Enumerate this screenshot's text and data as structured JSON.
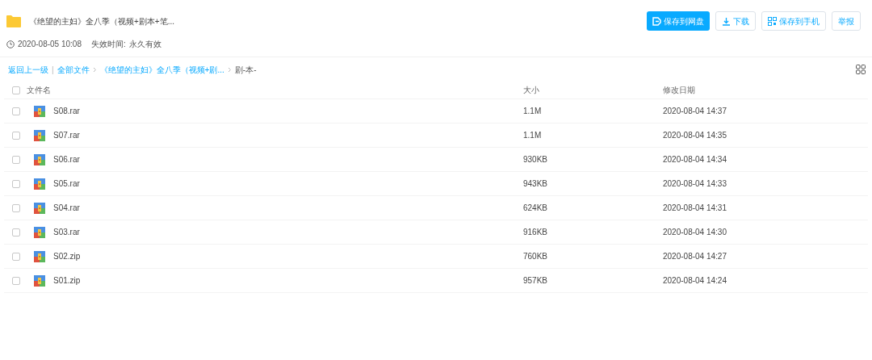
{
  "share": {
    "title": "《绝望的主妇》全八季（视频+剧本+笔...",
    "created": "2020-08-05 10:08",
    "expiry_label": "失效时间:",
    "expiry": "永久有效"
  },
  "actions": [
    {
      "kind": "save",
      "label": "保存到网盘"
    },
    {
      "kind": "download",
      "label": "下载"
    },
    {
      "kind": "phone",
      "label": "保存到手机"
    },
    {
      "kind": "report",
      "label": "举报"
    }
  ],
  "breadcrumb": {
    "back": "返回上一级",
    "divider": "|",
    "items": [
      {
        "label": "全部文件",
        "current": false
      },
      {
        "label": "《绝望的主妇》全八季（视频+剧...",
        "current": false
      },
      {
        "label": "剧-本-",
        "current": true
      }
    ]
  },
  "table": {
    "all_checked": false,
    "columns": [
      "文件名",
      "大小",
      "修改日期"
    ],
    "rows": [
      {
        "name": "S08.rar",
        "size": "1.1M",
        "date": "2020-08-04 14:37",
        "checked": false
      },
      {
        "name": "S07.rar",
        "size": "1.1M",
        "date": "2020-08-04 14:35",
        "checked": false
      },
      {
        "name": "S06.rar",
        "size": "930KB",
        "date": "2020-08-04 14:34",
        "checked": false
      },
      {
        "name": "S05.rar",
        "size": "943KB",
        "date": "2020-08-04 14:33",
        "checked": false
      },
      {
        "name": "S04.rar",
        "size": "624KB",
        "date": "2020-08-04 14:31",
        "checked": false
      },
      {
        "name": "S03.rar",
        "size": "916KB",
        "date": "2020-08-04 14:30",
        "checked": false
      },
      {
        "name": "S02.zip",
        "size": "760KB",
        "date": "2020-08-04 14:27",
        "checked": false
      },
      {
        "name": "S01.zip",
        "size": "957KB",
        "date": "2020-08-04 14:24",
        "checked": false
      }
    ]
  }
}
